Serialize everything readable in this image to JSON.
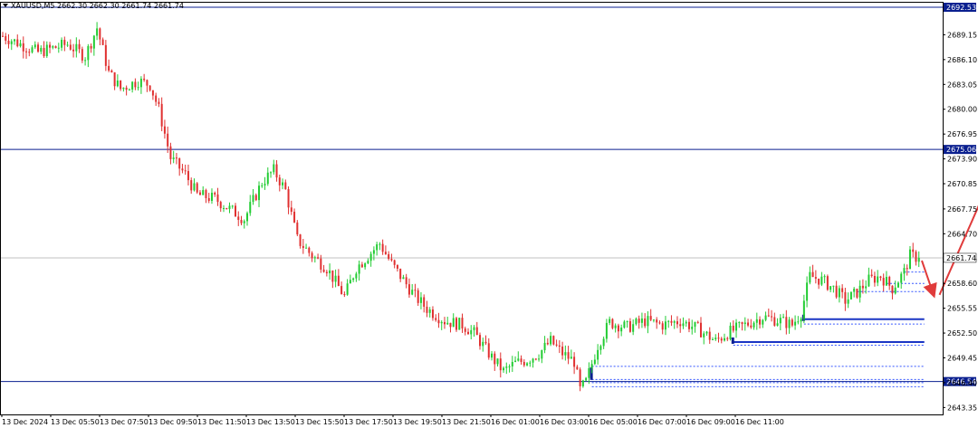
{
  "chart_data": {
    "type": "candlestick",
    "symbol_header": "XAUUSD,M5  2662.30 2662.30 2661.74 2661.74",
    "current_price": 2661.74,
    "ylim": [
      2642.5,
      2693.2
    ],
    "y_ticks": [
      "2689.15",
      "2686.10",
      "2683.05",
      "2680.00",
      "2676.95",
      "2673.90",
      "2670.85",
      "2667.75",
      "2664.70",
      "2661.65",
      "2658.60",
      "2655.55",
      "2652.50",
      "2649.45",
      "2646.40",
      "2643.35"
    ],
    "x_ticks": [
      "13 Dec 2024",
      "13 Dec 05:50",
      "13 Dec 07:50",
      "13 Dec 09:50",
      "13 Dec 11:50",
      "13 Dec 13:50",
      "13 Dec 15:50",
      "13 Dec 17:50",
      "13 Dec 19:50",
      "13 Dec 21:50",
      "16 Dec 01:00",
      "16 Dec 03:00",
      "16 Dec 05:00",
      "16 Dec 07:00",
      "16 Dec 09:00",
      "16 Dec 11:00"
    ],
    "horizontal_levels": [
      {
        "price": 2692.53,
        "label": "2692.53",
        "color": "#0a1f8f"
      },
      {
        "price": 2675.06,
        "label": "2675.06",
        "color": "#0a1f8f"
      },
      {
        "price": 2646.54,
        "label": "2646.54",
        "color": "#0a1f8f"
      }
    ],
    "current_price_label": "2661.74",
    "anchors": [
      [
        0,
        2689.0
      ],
      [
        12,
        2687.0
      ],
      [
        22,
        2688.0
      ],
      [
        28,
        2686.5
      ],
      [
        32,
        2690.0
      ],
      [
        36,
        2684.5
      ],
      [
        40,
        2682.5
      ],
      [
        46,
        2683.5
      ],
      [
        50,
        2683.0
      ],
      [
        53,
        2680.0
      ],
      [
        57,
        2674.0
      ],
      [
        62,
        2672.0
      ],
      [
        66,
        2669.5
      ],
      [
        72,
        2669.0
      ],
      [
        78,
        2667.5
      ],
      [
        82,
        2666.5
      ],
      [
        88,
        2671.0
      ],
      [
        92,
        2672.5
      ],
      [
        96,
        2670.0
      ],
      [
        100,
        2664.0
      ],
      [
        105,
        2662.0
      ],
      [
        110,
        2660.5
      ],
      [
        116,
        2657.0
      ],
      [
        120,
        2660.5
      ],
      [
        124,
        2662.0
      ],
      [
        128,
        2663.5
      ],
      [
        132,
        2661.0
      ],
      [
        136,
        2659.0
      ],
      [
        140,
        2657.0
      ],
      [
        144,
        2655.5
      ],
      [
        150,
        2654.0
      ],
      [
        156,
        2653.5
      ],
      [
        160,
        2652.5
      ],
      [
        166,
        2649.5
      ],
      [
        170,
        2647.8
      ],
      [
        174,
        2648.8
      ],
      [
        178,
        2649.2
      ],
      [
        182,
        2650.0
      ],
      [
        186,
        2651.5
      ],
      [
        190,
        2650.0
      ],
      [
        194,
        2649.0
      ],
      [
        196,
        2645.5
      ],
      [
        198,
        2646.5
      ],
      [
        202,
        2651.0
      ],
      [
        206,
        2653.8
      ],
      [
        212,
        2653.2
      ],
      [
        218,
        2654.0
      ],
      [
        224,
        2653.5
      ],
      [
        230,
        2654.0
      ],
      [
        236,
        2653.0
      ],
      [
        242,
        2651.5
      ],
      [
        246,
        2652.5
      ],
      [
        252,
        2653.5
      ],
      [
        258,
        2654.5
      ],
      [
        264,
        2654.0
      ],
      [
        268,
        2653.5
      ],
      [
        271,
        2655.0
      ],
      [
        274,
        2659.5
      ],
      [
        278,
        2659.0
      ],
      [
        282,
        2658.0
      ],
      [
        286,
        2656.5
      ],
      [
        290,
        2657.5
      ],
      [
        294,
        2659.0
      ],
      [
        298,
        2659.5
      ],
      [
        302,
        2658.0
      ],
      [
        306,
        2660.0
      ],
      [
        308,
        2662.0
      ],
      [
        311,
        2661.74
      ]
    ],
    "zones": [
      {
        "from": 2654.2,
        "to": 2654.2,
        "style": "solid",
        "start": 272,
        "color": "#1a35c4"
      },
      {
        "from": 2653.6,
        "to": 2653.6,
        "style": "dotted",
        "start": 272,
        "color": "#3355ff"
      },
      {
        "from": 2651.4,
        "to": 2651.4,
        "style": "solid",
        "start": 248,
        "color": "#1a35c4"
      },
      {
        "from": 2651.0,
        "to": 2651.0,
        "style": "dotted",
        "start": 248,
        "color": "#3355ff"
      },
      {
        "from": 2648.4,
        "to": 2648.4,
        "style": "dotted",
        "start": 200,
        "color": "#3355ff"
      },
      {
        "from": 2646.8,
        "to": 2646.8,
        "style": "dotted",
        "start": 200,
        "color": "#3355ff"
      },
      {
        "from": 2646.4,
        "to": 2646.4,
        "style": "dotted",
        "start": 200,
        "color": "#3355ff"
      },
      {
        "from": 2645.9,
        "to": 2645.9,
        "style": "dotted",
        "start": 200,
        "color": "#3355ff"
      },
      {
        "from": 2657.6,
        "to": 2657.6,
        "style": "dotted",
        "start": 290,
        "color": "#3355ff"
      },
      {
        "from": 2658.6,
        "to": 2658.6,
        "style": "dotted",
        "start": 300,
        "color": "#3355ff"
      },
      {
        "from": 2660.0,
        "to": 2660.0,
        "style": "dotted",
        "start": 306,
        "color": "#3355ff"
      }
    ],
    "arrows": [
      {
        "from": [
          312,
          2661.4
        ],
        "to": [
          316,
          2657.2
        ],
        "color": "#e03b3b"
      },
      {
        "from": [
          318,
          2657.2
        ],
        "to": [
          336,
          2672.0
        ],
        "color": "#e03b3b"
      }
    ],
    "colors": {
      "bull": "#22cc33",
      "bear": "#e03030",
      "background": "#ffffff",
      "axis": "#000000",
      "grid_current": "#c0c0c0"
    }
  }
}
